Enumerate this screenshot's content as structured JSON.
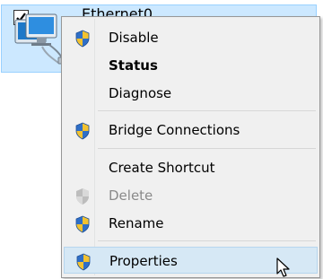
{
  "adapter": {
    "name": "Ethernet0",
    "checked": true,
    "icon": "network-adapter-icon"
  },
  "menu": {
    "items": [
      {
        "label": "Disable",
        "icon": "shield-icon",
        "style": "normal"
      },
      {
        "label": "Status",
        "icon": "",
        "style": "bold"
      },
      {
        "label": "Diagnose",
        "icon": "",
        "style": "normal"
      },
      {
        "label": "Bridge Connections",
        "icon": "shield-icon",
        "style": "normal"
      },
      {
        "label": "Create Shortcut",
        "icon": "",
        "style": "normal"
      },
      {
        "label": "Delete",
        "icon": "shield-icon",
        "style": "disabled"
      },
      {
        "label": "Rename",
        "icon": "shield-icon",
        "style": "normal"
      },
      {
        "label": "Properties",
        "icon": "shield-icon",
        "style": "highlighted"
      }
    ]
  },
  "colors": {
    "selection_background": "#cce8ff",
    "menu_background": "#f0f0f0",
    "highlight_background": "#d6e8f5",
    "disabled_text": "#8a8a8a"
  }
}
